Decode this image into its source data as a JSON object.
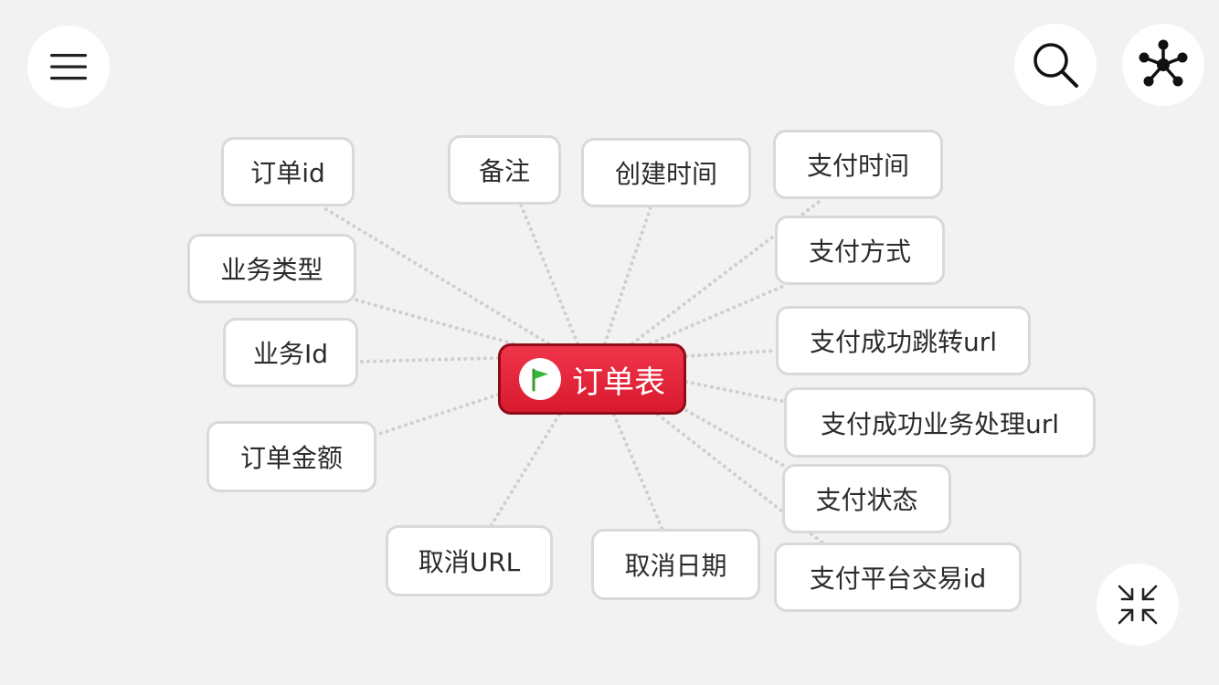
{
  "toolbar": {
    "menu_icon": "hamburger-menu-icon",
    "search_icon": "search-icon",
    "structure_icon": "mindmap-structure-icon",
    "collapse_icon": "collapse-arrows-icon"
  },
  "mindmap": {
    "root": {
      "label": "订单表",
      "icon": "green-flag-icon",
      "color": "#e8243a"
    },
    "nodes": [
      {
        "id": "n1",
        "label": "订单id"
      },
      {
        "id": "n2",
        "label": "业务类型"
      },
      {
        "id": "n3",
        "label": "业务Id"
      },
      {
        "id": "n4",
        "label": "订单金额"
      },
      {
        "id": "n5",
        "label": "备注"
      },
      {
        "id": "n6",
        "label": "创建时间"
      },
      {
        "id": "n7",
        "label": "取消URL"
      },
      {
        "id": "n8",
        "label": "取消日期"
      },
      {
        "id": "n9",
        "label": "支付时间"
      },
      {
        "id": "n10",
        "label": "支付方式"
      },
      {
        "id": "n11",
        "label": "支付成功跳转url"
      },
      {
        "id": "n12",
        "label": "支付成功业务处理url"
      },
      {
        "id": "n13",
        "label": "支付状态"
      },
      {
        "id": "n14",
        "label": "支付平台交易id"
      }
    ]
  }
}
